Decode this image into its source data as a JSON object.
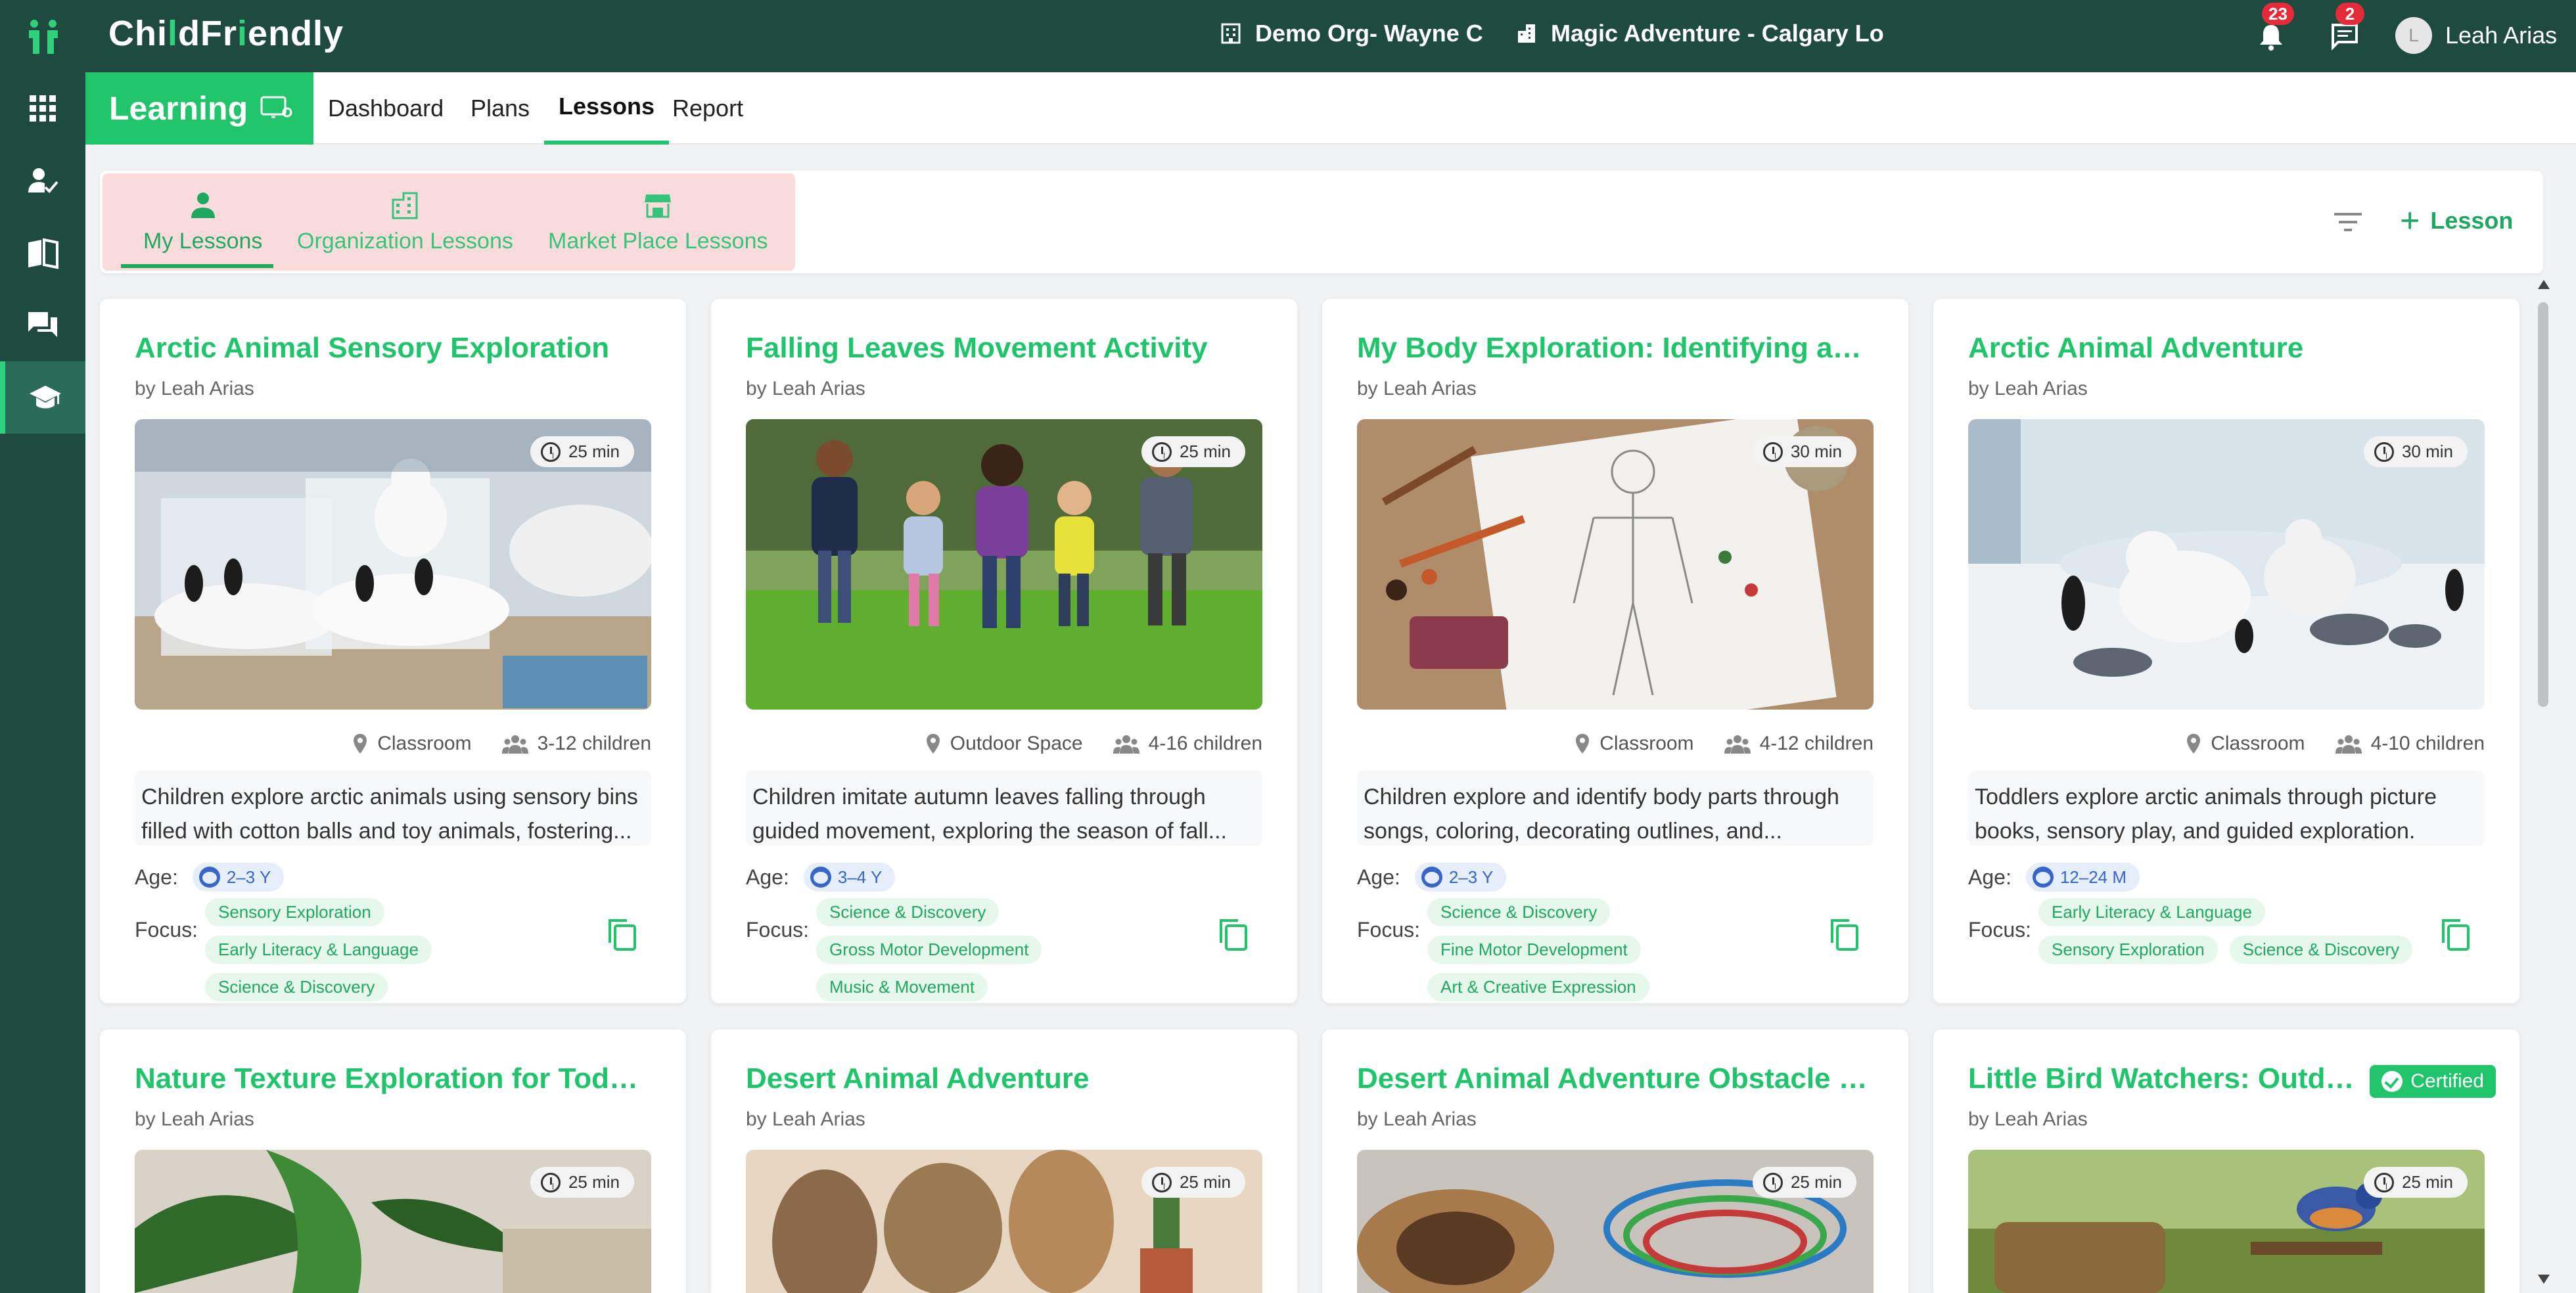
{
  "app": {
    "brand_pre": "Chi",
    "brand_i": "l",
    "brand_mid": "dFr",
    "brand_i2": "i",
    "brand_post": "endly"
  },
  "header": {
    "org": "Demo Org- Wayne C",
    "site": "Magic Adventure - Calgary Lo",
    "notifications_count": "23",
    "messages_count": "2",
    "user_initial": "L",
    "user_name": "Leah Arias"
  },
  "subnav": {
    "section": "Learning",
    "links": [
      "Dashboard",
      "Plans",
      "Lessons",
      "Report"
    ],
    "active": "Lessons"
  },
  "lesson_tabs": {
    "items": [
      "My Lessons",
      "Organization Lessons",
      "Market Place Lessons"
    ],
    "active": "My Lessons",
    "add_label": "Lesson"
  },
  "labels": {
    "age": "Age:",
    "focus": "Focus:"
  },
  "cards": [
    {
      "title": "Arctic Animal Sensory Exploration",
      "author": "by Leah Arias",
      "duration": "25 min",
      "location": "Classroom",
      "children": "3-12 children",
      "description": "Children explore arctic animals using sensory bins filled with cotton balls and toy animals, fostering...",
      "age": "2–3 Y",
      "focus": [
        "Sensory Exploration",
        "Early Literacy & Language",
        "Science & Discovery"
      ]
    },
    {
      "title": "Falling Leaves Movement Activity",
      "author": "by Leah Arias",
      "duration": "25 min",
      "location": "Outdoor Space",
      "children": "4-16 children",
      "description": "Children imitate autumn leaves falling through guided movement, exploring the season of fall...",
      "age": "3–4 Y",
      "focus": [
        "Science & Discovery",
        "Gross Motor Development",
        "Music & Movement"
      ]
    },
    {
      "title": "My Body Exploration: Identifying and ...",
      "author": "by Leah Arias",
      "duration": "30 min",
      "location": "Classroom",
      "children": "4-12 children",
      "description": "Children explore and identify body parts through songs, coloring, decorating outlines, and...",
      "age": "2–3 Y",
      "focus": [
        "Science & Discovery",
        "Fine Motor Development",
        "Art & Creative Expression"
      ]
    },
    {
      "title": "Arctic Animal Adventure",
      "author": "by Leah Arias",
      "duration": "30 min",
      "location": "Classroom",
      "children": "4-10 children",
      "description": "Toddlers explore arctic animals through picture books, sensory play, and guided exploration.",
      "age": "12–24 M",
      "focus": [
        "Early Literacy & Language",
        "Sensory Exploration",
        "Science & Discovery"
      ]
    },
    {
      "title": "Nature Texture Exploration for Toddl...",
      "author": "by Leah Arias",
      "duration": "25 min"
    },
    {
      "title": "Desert Animal Adventure",
      "author": "by Leah Arias",
      "duration": "25 min"
    },
    {
      "title": "Desert Animal Adventure Obstacle C...",
      "author": "by Leah Arias",
      "duration": "25 min"
    },
    {
      "title": "Little Bird Watchers: Outdo...",
      "author": "by Leah Arias",
      "duration": "25 min",
      "certified": "Certified"
    }
  ],
  "colors": {
    "topbar": "#1f4a40",
    "accent": "#20c46a",
    "badge": "#e52b3a",
    "tabs_highlight": "#fbdcdc"
  }
}
